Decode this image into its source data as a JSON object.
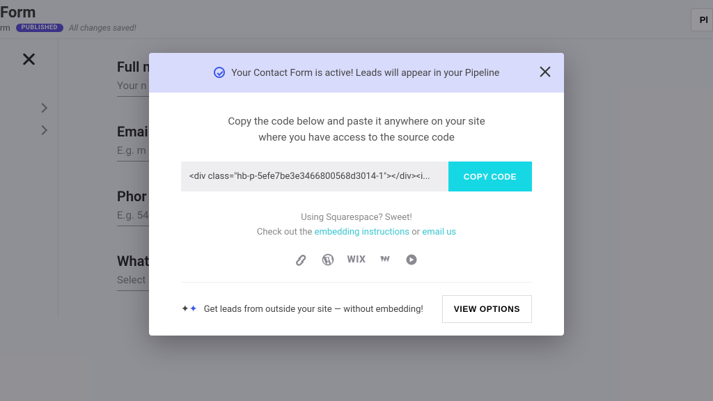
{
  "header": {
    "title": "Form",
    "subtitle_prefix": "rm",
    "badge": "PUBLISHED",
    "saved": "All changes saved!",
    "top_right_btn": "Pl"
  },
  "sidebar": {},
  "form": {
    "fields": [
      {
        "label": "Full n",
        "placeholder": "Your n"
      },
      {
        "label": "Emai",
        "placeholder": "E.g. m"
      },
      {
        "label": "Phor",
        "placeholder": "E.g. 54"
      },
      {
        "label": "What",
        "placeholder": "Select an option"
      }
    ]
  },
  "modal": {
    "banner": "Your Contact Form is active! Leads will appear in your Pipeline",
    "instr_line1": "Copy the code below and paste it anywhere on your site",
    "instr_line2": "where you have access to the source code",
    "code_snippet": "<div class=\"hb-p-5efe7be3e3466800568d3014-1\"></div><i...",
    "copy_btn": "COPY CODE",
    "sq_line1": "Using Squarespace? Sweet!",
    "sq_prefix": "Check out the ",
    "sq_link1": "embedding instructions",
    "sq_mid": "  or  ",
    "sq_link2": "email us",
    "platforms": {
      "wix_label": "WIX"
    },
    "footer_text": "Get leads from outside your site — without embedding!",
    "view_btn": "VIEW OPTIONS"
  }
}
